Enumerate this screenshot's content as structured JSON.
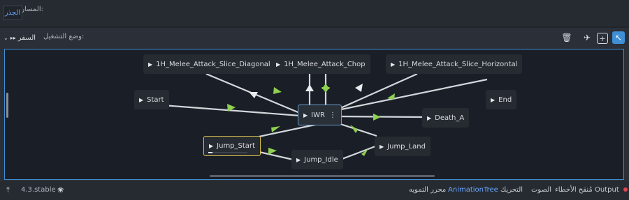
{
  "path_bar": {
    "label": "المسار:",
    "root_button": "الجذر"
  },
  "toolbar": {
    "play_mode_label": "وضع التشغيل:",
    "play_mode_value": "السفر",
    "play_mode_icon": "travel-icon",
    "tools": [
      "delete-icon",
      "airplane-icon",
      "add-node-icon",
      "select-arrow-icon"
    ]
  },
  "graph": {
    "nodes": {
      "diag": "1H_Melee_Attack_Slice_Diagonal",
      "chop": "1H_Melee_Attack_Chop",
      "horiz": "1H_Melee_Attack_Slice_Horizontal",
      "start": "Start",
      "end": "End",
      "iwr": "IWR",
      "death": "Death_A",
      "jump_start": "Jump_Start",
      "jump_land": "Jump_Land",
      "jump_idle": "Jump_Idle"
    },
    "jump_start_progress": 0.1,
    "colors": {
      "transition_active": "#8fd14f",
      "transition_idle": "#d3d6db",
      "selection": "#3e8fd6",
      "current": "#d8c04e"
    }
  },
  "status_bar": {
    "version": "4.3.stable",
    "tabs": {
      "output": "Output",
      "debugger": "مُنقح الأخطاء",
      "audio": "الصوت",
      "animation": "التحريك",
      "animation_tree": "AnimationTree",
      "shader_editor": "محرر التمويه"
    },
    "output_alert_color": "#e0464e"
  }
}
